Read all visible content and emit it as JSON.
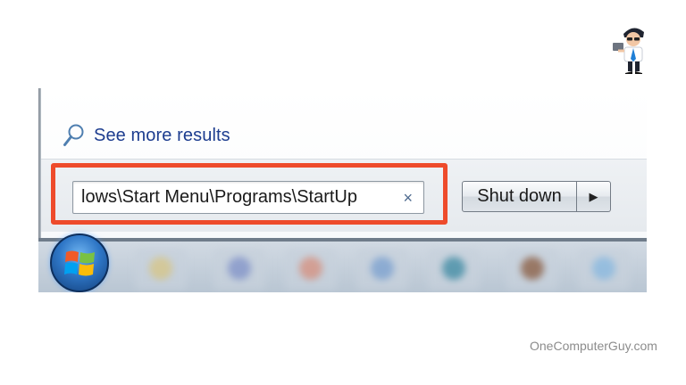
{
  "search_menu": {
    "see_more_label": "See more results",
    "search_value": "lows\\Start Menu\\Programs\\StartUp",
    "clear_glyph": "×",
    "icons": {
      "see_more": "magnifier-icon",
      "clear": "close-icon",
      "start": "windows-logo-icon"
    }
  },
  "shutdown": {
    "label": "Shut down",
    "arrow_glyph": "▶"
  },
  "taskbar": {
    "apps": [
      "taskbar-app",
      "taskbar-app",
      "taskbar-app",
      "taskbar-app",
      "taskbar-app",
      "taskbar-app",
      "taskbar-app"
    ]
  },
  "highlight_color": "#ee4b2b",
  "watermark": "OneComputerGuy.com"
}
